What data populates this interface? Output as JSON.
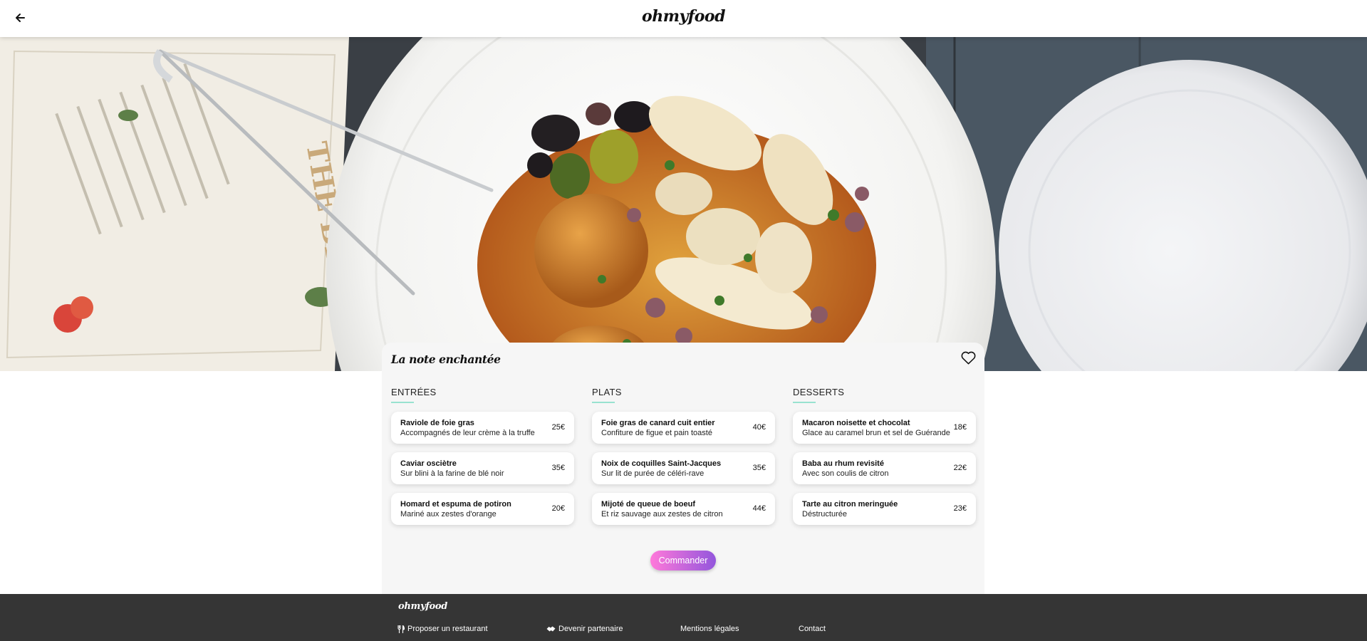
{
  "header": {
    "back_icon": "arrow-left-icon",
    "logo": "ohmyfood"
  },
  "hero": {
    "description_image": "restaurant-dish-photo"
  },
  "restaurant": {
    "name": "La note enchantée",
    "favorite_icon": "heart-outline-icon"
  },
  "menu": {
    "sections": [
      {
        "title": "ENTRÉES",
        "items": [
          {
            "name": "Raviole de foie gras",
            "desc": "Accompagnés de leur crème à la truffe",
            "price": "25€"
          },
          {
            "name": "Caviar osciètre",
            "desc": "Sur blini à la farine de blé noir",
            "price": "35€"
          },
          {
            "name": "Homard et espuma de potiron",
            "desc": "Mariné aux zestes d'orange",
            "price": "20€"
          }
        ]
      },
      {
        "title": "PLATS",
        "items": [
          {
            "name": "Foie gras de canard cuit entier",
            "desc": "Confiture de figue et pain toasté",
            "price": "40€"
          },
          {
            "name": "Noix de coquilles Saint-Jacques",
            "desc": "Sur lit de purée de céléri-rave",
            "price": "35€"
          },
          {
            "name": "Mijoté de queue de boeuf",
            "desc": "Et riz sauvage aux zestes de citron",
            "price": "44€"
          }
        ]
      },
      {
        "title": "DESSERTS",
        "items": [
          {
            "name": "Macaron noisette et chocolat",
            "desc": "Glace au caramel brun et sel de Guérande",
            "price": "18€"
          },
          {
            "name": "Baba au rhum revisité",
            "desc": "Avec son coulis de citron",
            "price": "22€"
          },
          {
            "name": "Tarte au citron meringuée",
            "desc": "Déstructurée",
            "price": "23€"
          }
        ]
      }
    ],
    "order_button": "Commander"
  },
  "footer": {
    "logo": "ohmyfood",
    "links": [
      {
        "label": "Proposer un restaurant",
        "icon": "utensils-icon"
      },
      {
        "label": "Devenir partenaire",
        "icon": "handshake-icon"
      },
      {
        "label": "Mentions légales",
        "icon": ""
      },
      {
        "label": "Contact",
        "icon": ""
      }
    ]
  },
  "colors": {
    "accent_underline": "#99e2d0",
    "button_gradient_start": "#ff79da",
    "button_gradient_end": "#9356dc",
    "footer_bg": "#353535"
  }
}
